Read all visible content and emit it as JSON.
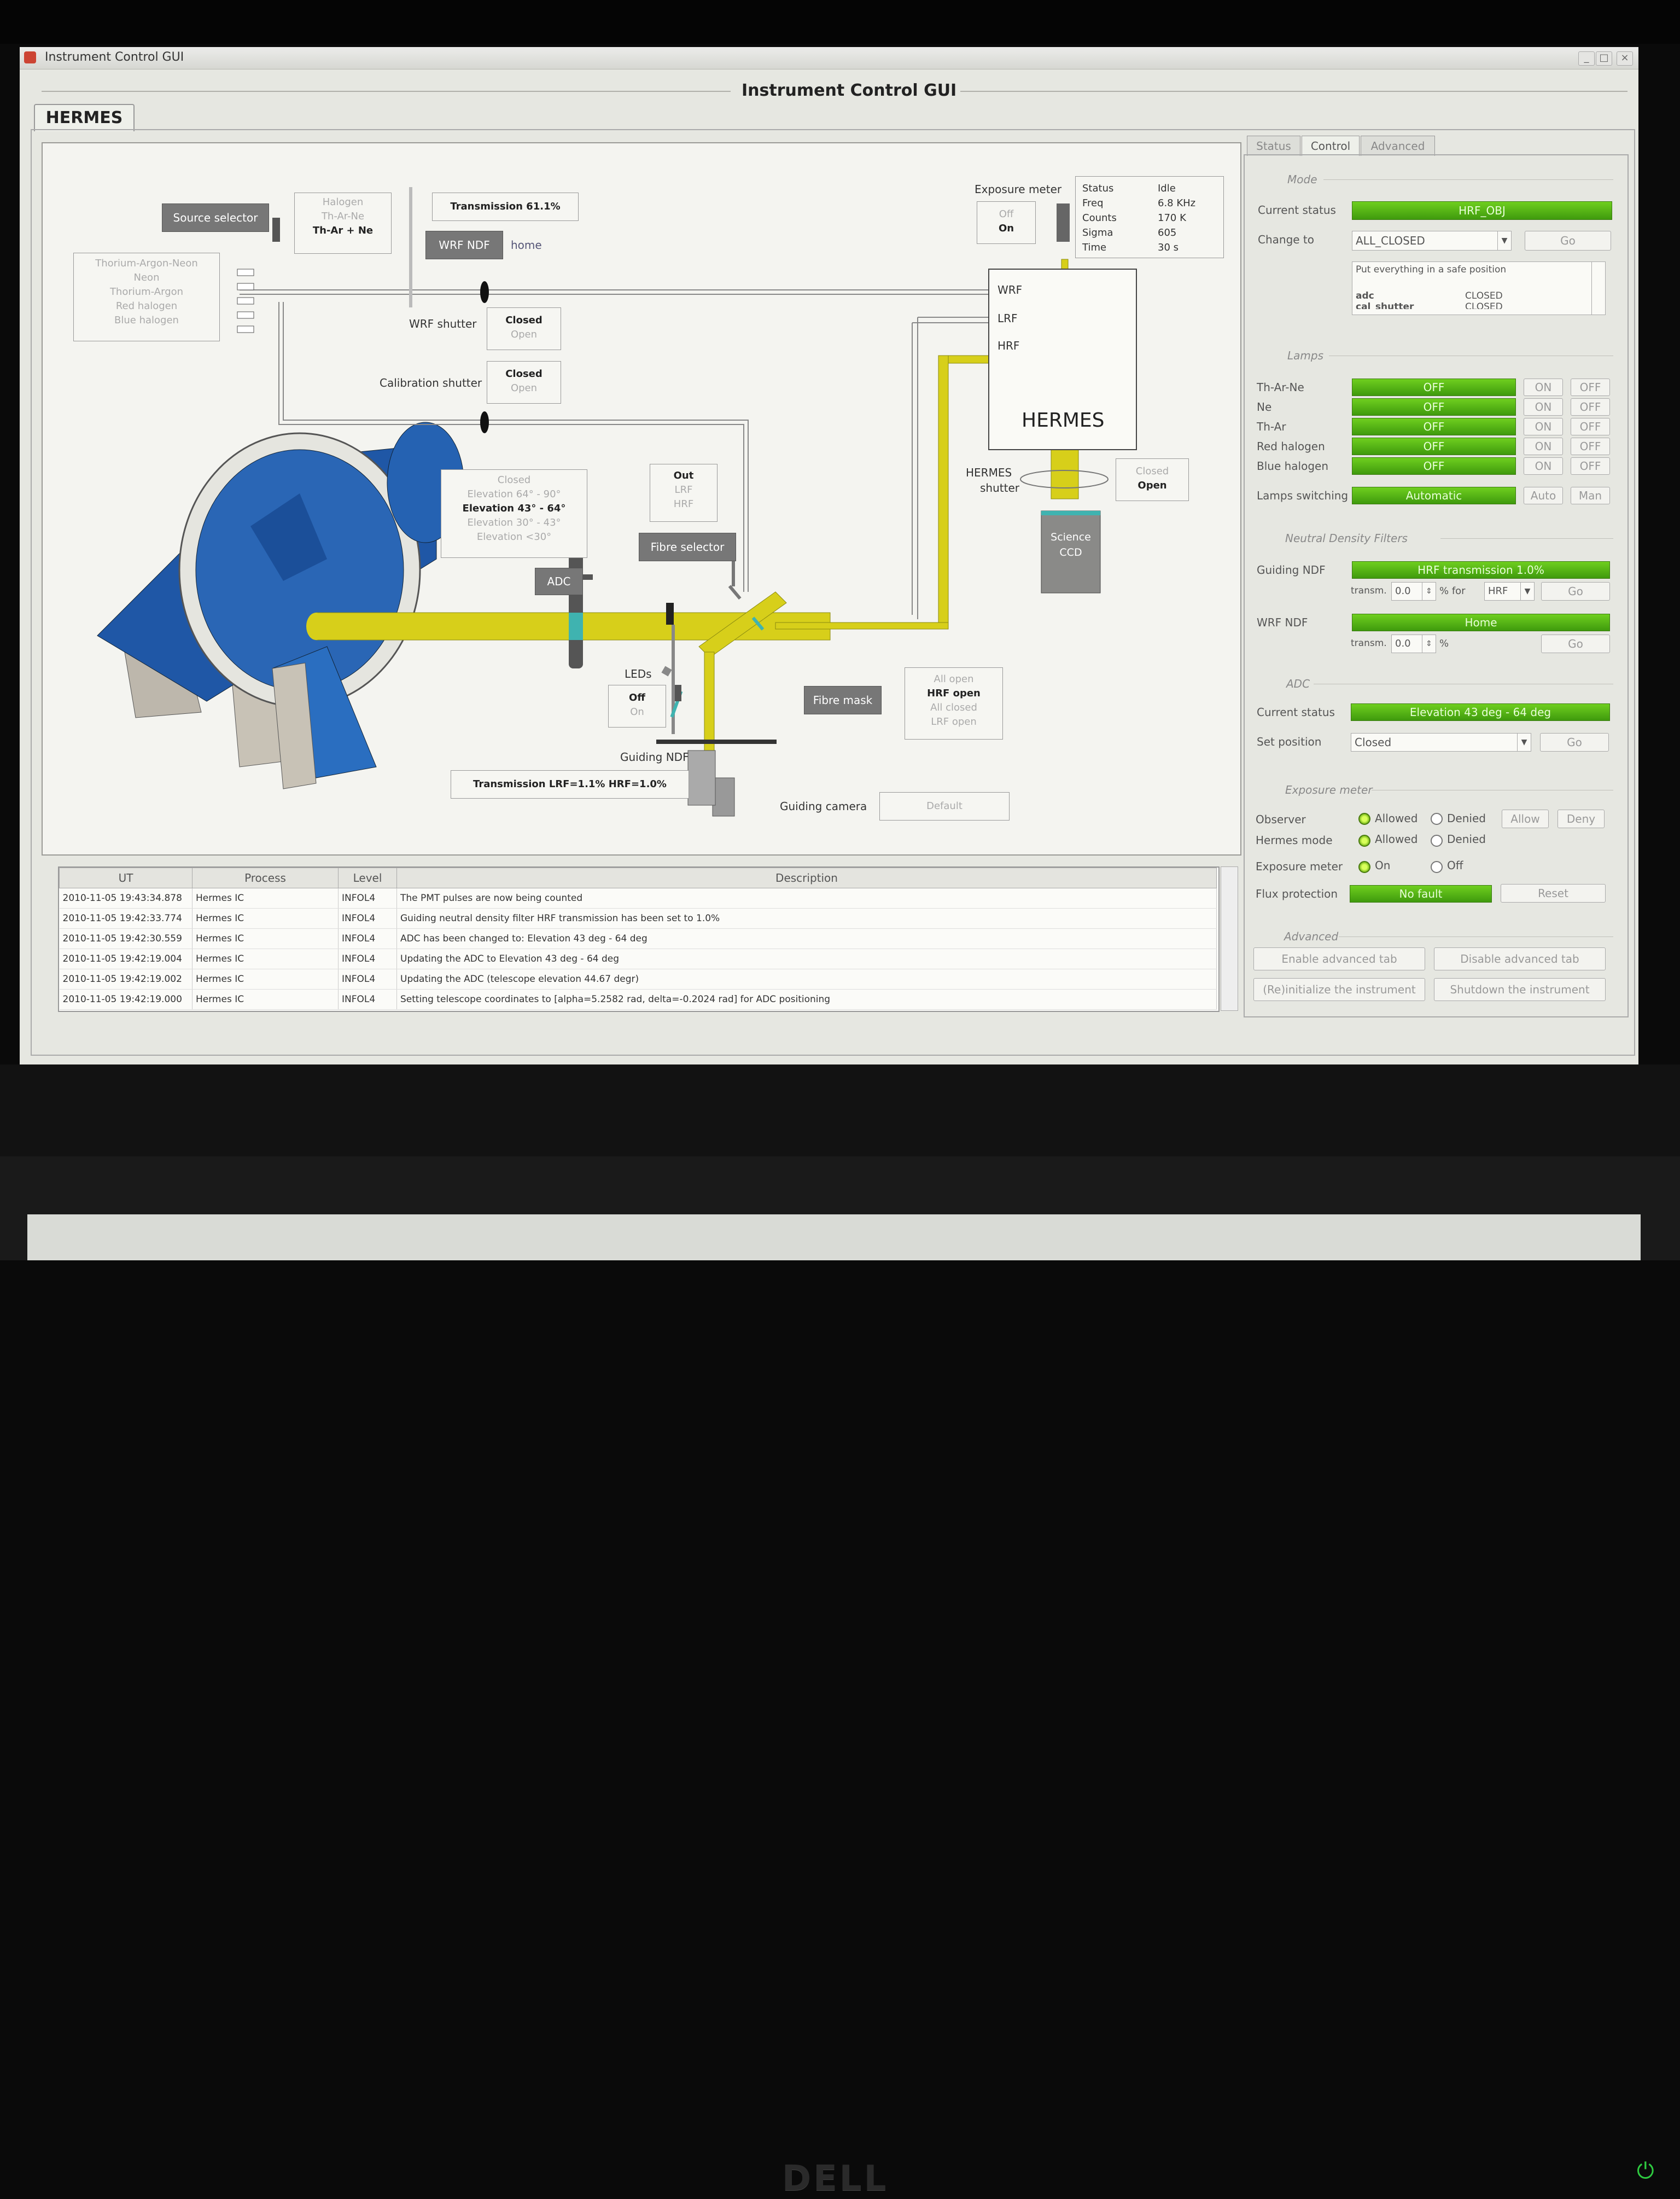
{
  "window": {
    "title": "Instrument Control GUI",
    "heading": "Instrument Control GUI",
    "main_tab": "HERMES"
  },
  "diagram": {
    "source_selector": "Source selector",
    "lamp_selector": [
      "Halogen",
      "Th-Ar-Ne",
      "Th-Ar + Ne"
    ],
    "source_list": [
      "Thorium-Argon-Neon",
      "Neon",
      "Thorium-Argon",
      "Red halogen",
      "Blue halogen"
    ],
    "transmission_wrf": "Transmission 61.1%",
    "wrf_ndf": "WRF NDF",
    "wrf_ndf_state": "home",
    "wrf_shutter": {
      "label": "WRF shutter",
      "options": [
        "Closed",
        "Open"
      ]
    },
    "calibration_shutter": {
      "label": "Calibration shutter",
      "options": [
        "Closed",
        "Open"
      ]
    },
    "exposure_meter": {
      "label": "Exposure meter",
      "options": [
        "Off",
        "On"
      ]
    },
    "status_box": {
      "rows": [
        {
          "k": "Status",
          "v": "Idle"
        },
        {
          "k": "Freq",
          "v": "6.8 KHz"
        },
        {
          "k": "Counts",
          "v": "170 K"
        },
        {
          "k": "Sigma",
          "v": "605"
        },
        {
          "k": "Time",
          "v": "30 s"
        }
      ]
    },
    "fibres": [
      "WRF",
      "LRF",
      "HRF"
    ],
    "spectrograph": "HERMES",
    "hermes_shutter": {
      "label1": "HERMES",
      "label2": "shutter",
      "options": [
        "Closed",
        "Open"
      ]
    },
    "science_ccd": {
      "line1": "Science",
      "line2": "CCD"
    },
    "adc_selector": [
      "Closed",
      "Elevation 64° - 90°",
      "Elevation 43° - 64°",
      "Elevation 30° - 43°",
      "Elevation <30°"
    ],
    "fibre_sel_options": [
      "Out",
      "LRF",
      "HRF"
    ],
    "fibre_selector": "Fibre selector",
    "adc": "ADC",
    "leds": {
      "label": "LEDs",
      "options": [
        "Off",
        "On"
      ]
    },
    "fibre_mask": "Fibre mask",
    "fibre_mask_options": [
      "All open",
      "HRF open",
      "All closed",
      "LRF open"
    ],
    "guiding_ndf": "Guiding NDF",
    "transmission_guiding": "Transmission LRF=1.1% HRF=1.0%",
    "guiding_camera": "Guiding camera",
    "default_button": "Default"
  },
  "log": {
    "columns": [
      "UT",
      "Process",
      "Level",
      "Description"
    ],
    "rows": [
      [
        "2010-11-05 19:43:34.878",
        "Hermes IC",
        "INFOL4",
        "The PMT pulses are now being counted"
      ],
      [
        "2010-11-05 19:42:33.774",
        "Hermes IC",
        "INFOL4",
        "Guiding neutral density filter HRF transmission has been set to 1.0%"
      ],
      [
        "2010-11-05 19:42:30.559",
        "Hermes IC",
        "INFOL4",
        "ADC has been changed to: Elevation 43 deg - 64 deg"
      ],
      [
        "2010-11-05 19:42:19.004",
        "Hermes IC",
        "INFOL4",
        "Updating the ADC to Elevation 43 deg - 64 deg"
      ],
      [
        "2010-11-05 19:42:19.002",
        "Hermes IC",
        "INFOL4",
        "Updating the ADC (telescope elevation 44.67 degr)"
      ],
      [
        "2010-11-05 19:42:19.000",
        "Hermes IC",
        "INFOL4",
        "Setting telescope coordinates to [alpha=5.2582 rad, delta=-0.2024 rad] for ADC positioning"
      ]
    ]
  },
  "panel": {
    "tabs": [
      "Status",
      "Control",
      "Advanced"
    ],
    "mode": {
      "title": "Mode",
      "current_status_label": "Current status",
      "current_status": "HRF_OBJ",
      "change_to_label": "Change to",
      "change_to": "ALL_CLOSED",
      "go": "Go",
      "description": "Put everything in a safe position",
      "desc_rows": [
        {
          "k": "adc",
          "v": "CLOSED"
        },
        {
          "k": "cal_shutter",
          "v": "CLOSED"
        }
      ]
    },
    "lamps": {
      "title": "Lamps",
      "items": [
        {
          "name": "Th-Ar-Ne",
          "state": "OFF"
        },
        {
          "name": "Ne",
          "state": "OFF"
        },
        {
          "name": "Th-Ar",
          "state": "OFF"
        },
        {
          "name": "Red halogen",
          "state": "OFF"
        },
        {
          "name": "Blue halogen",
          "state": "OFF"
        }
      ],
      "on": "ON",
      "off": "OFF",
      "switching_label": "Lamps switching",
      "switching": "Automatic",
      "auto": "Auto",
      "man": "Man"
    },
    "ndf": {
      "title": "Neutral Density Filters",
      "guiding_label": "Guiding NDF",
      "guiding_status": "HRF transmission 1.0%",
      "transm_label": "transm.",
      "guiding_value": "0.0",
      "pct_for": "% for",
      "fibre": "HRF",
      "go": "Go",
      "wrf_label": "WRF NDF",
      "wrf_status": "Home",
      "wrf_value": "0.0",
      "pct": "%"
    },
    "adc": {
      "title": "ADC",
      "current_label": "Current status",
      "current": "Elevation 43 deg - 64 deg",
      "set_label": "Set position",
      "set_value": "Closed",
      "go": "Go"
    },
    "exposure": {
      "title": "Exposure meter",
      "observer_label": "Observer",
      "hermes_mode_label": "Hermes mode",
      "meter_label": "Exposure meter",
      "allowed": "Allowed",
      "denied": "Denied",
      "on": "On",
      "off": "Off",
      "allow_btn": "Allow",
      "deny_btn": "Deny",
      "flux_label": "Flux protection",
      "flux_status": "No fault",
      "reset": "Reset"
    },
    "advanced": {
      "title": "Advanced",
      "enable": "Enable advanced tab",
      "disable": "Disable advanced tab",
      "reinit": "(Re)initialize the instrument",
      "shutdown": "Shutdown the instrument"
    }
  },
  "monitor": {
    "brand": "DELL",
    "power_icon": "power-icon"
  }
}
